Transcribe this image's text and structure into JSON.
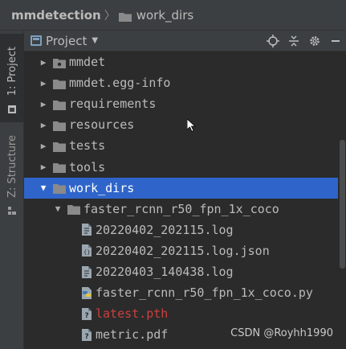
{
  "breadcrumb": {
    "root": "mmdetection",
    "separator": "〉",
    "current": "work_dirs"
  },
  "toolstrip": {
    "project_tab": "1: Project",
    "structure_tab": "Z: Structure"
  },
  "panel": {
    "title": "Project",
    "tools": [
      "locate-icon",
      "collapse-all-icon",
      "gear-icon",
      "hide-icon"
    ]
  },
  "tree": {
    "rows": [
      {
        "label": "mmdet",
        "type": "folder",
        "expanded": false,
        "depth": 0
      },
      {
        "label": "mmdet.egg-info",
        "type": "folder",
        "expanded": false,
        "depth": 0
      },
      {
        "label": "requirements",
        "type": "folder",
        "expanded": false,
        "depth": 0
      },
      {
        "label": "resources",
        "type": "folder",
        "expanded": false,
        "depth": 0
      },
      {
        "label": "tests",
        "type": "folder",
        "expanded": false,
        "depth": 0
      },
      {
        "label": "tools",
        "type": "folder",
        "expanded": false,
        "depth": 0
      },
      {
        "label": "work_dirs",
        "type": "folder",
        "expanded": true,
        "depth": 0,
        "selected": true
      },
      {
        "label": "faster_rcnn_r50_fpn_1x_coco",
        "type": "folder",
        "expanded": true,
        "depth": 1
      },
      {
        "label": "20220402_202115.log",
        "type": "file-text",
        "depth": 2
      },
      {
        "label": "20220402_202115.log.json",
        "type": "file-json",
        "depth": 2
      },
      {
        "label": "20220403_140438.log",
        "type": "file-text",
        "depth": 2
      },
      {
        "label": "faster_rcnn_r50_fpn_1x_coco.py",
        "type": "file-python",
        "depth": 2
      },
      {
        "label": "latest.pth",
        "type": "file-unknown",
        "depth": 2,
        "color": "#cc3f3f"
      },
      {
        "label": "metric.pdf",
        "type": "file-unknown",
        "depth": 2
      }
    ]
  },
  "watermark": "CSDN @Royhh1990",
  "colors": {
    "selection": "#2f65ca",
    "folder": "#8a8a8a",
    "background": "#2b2b2b",
    "chrome": "#3c3f41"
  }
}
